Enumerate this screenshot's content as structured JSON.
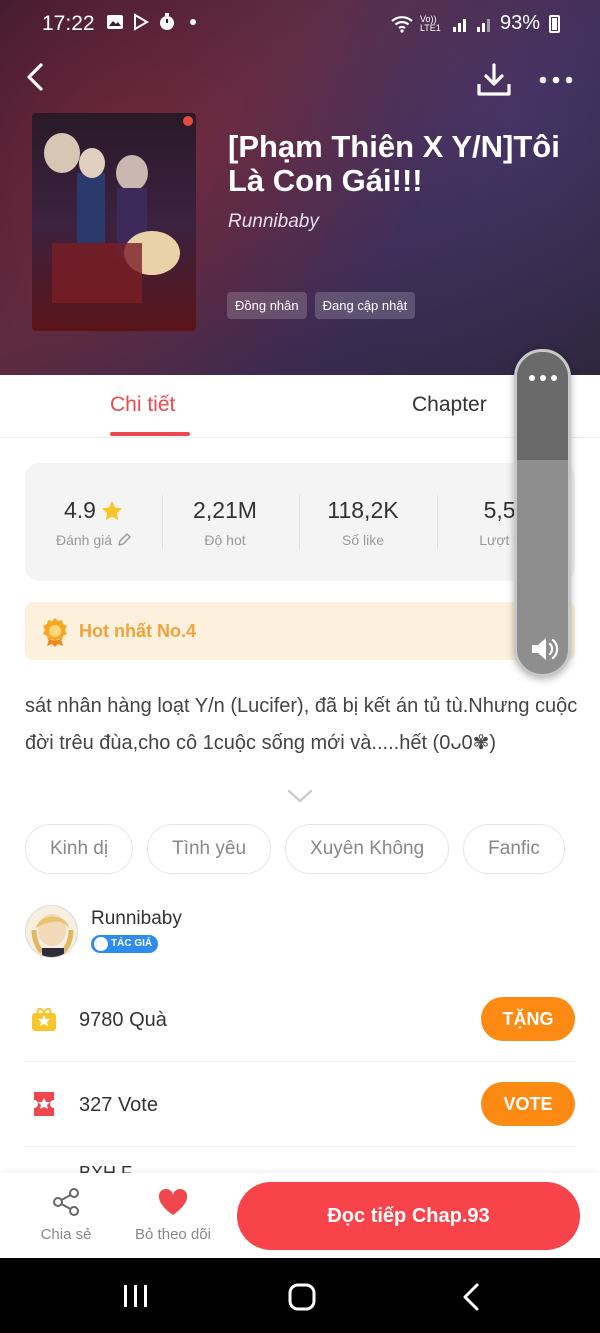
{
  "status_bar": {
    "time": "17:22",
    "battery": "93%",
    "network_label": "Vo)) LTE1"
  },
  "book": {
    "title": "[Phạm Thiên X Y/N]Tôi Là Con Gái!!!",
    "author": "Runnibaby",
    "tags": [
      "Đồng nhân",
      "Đang cập nhật"
    ]
  },
  "tabs": {
    "detail": "Chi tiết",
    "chapter": "Chapter",
    "active": "detail"
  },
  "stats": [
    {
      "value": "4.9",
      "label": "Đánh giá"
    },
    {
      "value": "2,21M",
      "label": "Độ hot"
    },
    {
      "value": "118,2K",
      "label": "Số like"
    },
    {
      "value": "5,51",
      "label": "Lượt the"
    }
  ],
  "hot_banner": {
    "text": "Hot nhất No.4"
  },
  "description": "sát nhân hàng loạt Y/n (Lucifer), đã bị kết án tủ tù.Nhưng cuộc đời trêu đùa,cho cô 1cuộc sống mới và.....hết (0ᴗ0✾)",
  "genres": [
    "Kinh dị",
    "Tình yêu",
    "Xuyên Không",
    "Fanfic"
  ],
  "author_section": {
    "name": "Runnibaby",
    "badge": "TÁC GIẢ"
  },
  "gift": {
    "count": "9780",
    "label": "Quà",
    "button": "TẶNG"
  },
  "vote": {
    "count": "327",
    "label": "Vote",
    "button": "VOTE"
  },
  "partial_row_text": "BXH F",
  "bottom_bar": {
    "share": "Chia sẻ",
    "unfollow": "Bỏ theo dõi",
    "read": "Đọc tiếp Chap.93"
  },
  "colors": {
    "accent_red": "#f0474f",
    "read_button": "#f9434b",
    "orange_button": "#fd8a12",
    "hot_text": "#f0a33a",
    "star": "#f7c628"
  },
  "icons": {
    "back": "back-arrow-icon",
    "download": "download-icon",
    "more": "more-dots-icon",
    "star": "star-icon",
    "edit": "pencil-icon",
    "medal": "medal-icon",
    "gift": "gift-icon",
    "ticket": "ticket-icon",
    "share": "share-icon",
    "heart": "heart-icon",
    "speaker": "speaker-icon"
  }
}
